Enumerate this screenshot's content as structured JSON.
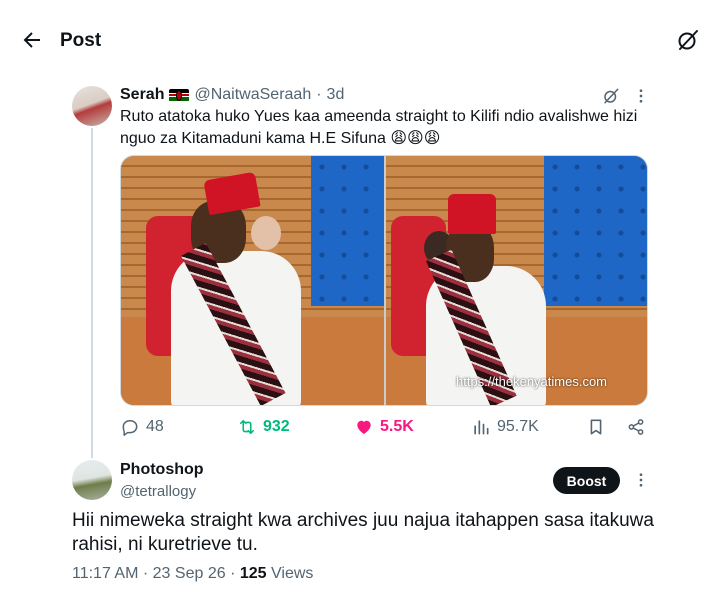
{
  "header": {
    "title": "Post",
    "back_icon": "arrow-left-icon",
    "grok_icon": "grok-icon"
  },
  "quoted": {
    "author_name": "Serah",
    "flag_icon": "kenya-flag-icon",
    "handle": "@NaitwaSeraah",
    "separator": "·",
    "time": "3d",
    "text": "Ruto atatoka huko Yues kaa ameenda straight to Kilifi ndio avalishwe hizi nguo za Kitamaduni kama H.E Sifuna 😩😩😩",
    "watermark": "https://thekenyatimes.com",
    "actions": {
      "replies": "48",
      "reposts": "932",
      "likes": "5.5K",
      "views": "95.7K"
    },
    "colors": {
      "repost": "#00ba7c",
      "like": "#f91880",
      "muted": "#536471"
    }
  },
  "post": {
    "author_name": "Photoshop",
    "handle": "@tetrallogy",
    "boost_label": "Boost",
    "text": "Hii nimeweka straight kwa archives juu najua itahappen sasa itakuwa rahisi, ni kuretrieve tu.",
    "time": "11:17 AM",
    "dot1": "·",
    "date": "23 Sep 26",
    "dot2": "·",
    "views_count": "125",
    "views_label": "Views"
  }
}
